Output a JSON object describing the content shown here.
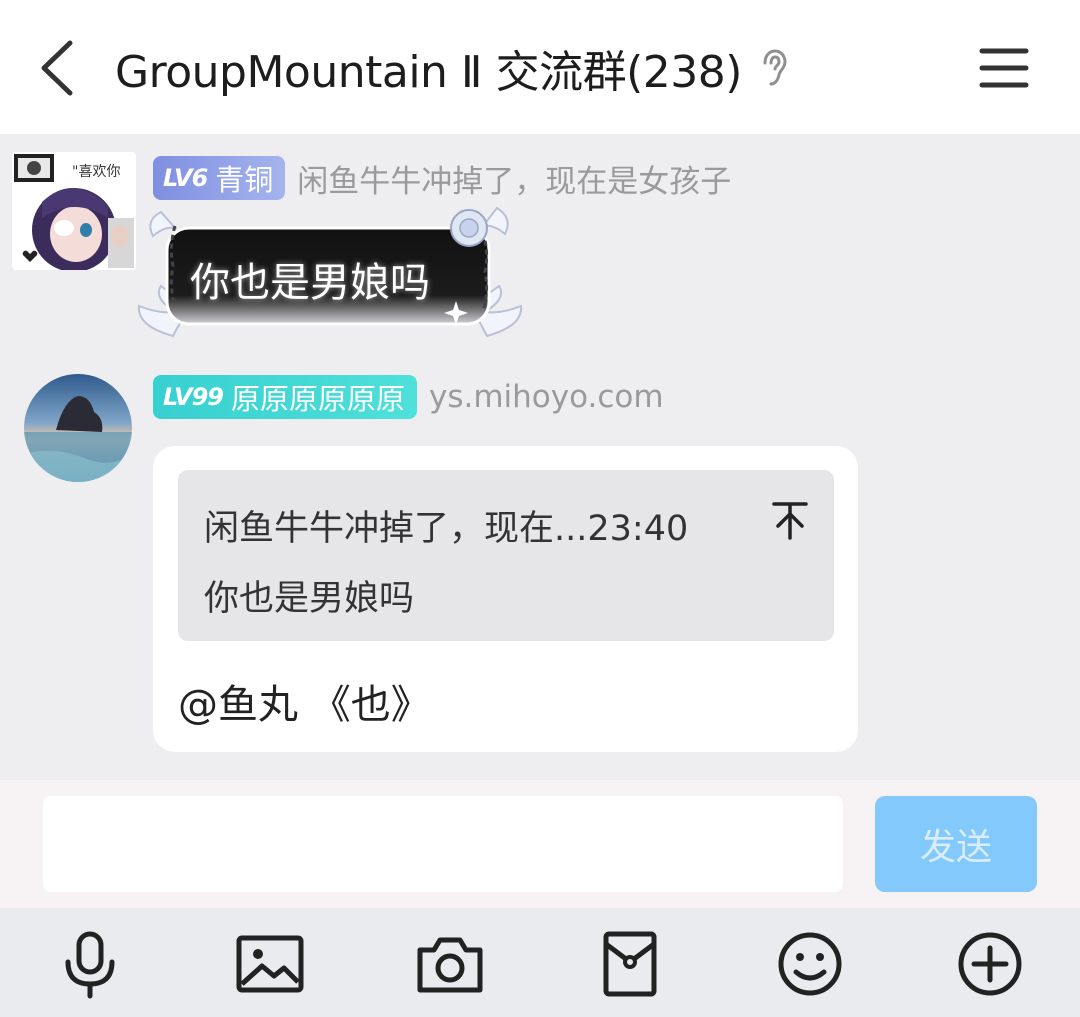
{
  "header": {
    "title": "GroupMountain Ⅱ 交流群(238)",
    "back_icon": "chevron-left-icon",
    "listen_icon": "ear-icon",
    "menu_icon": "hamburger-menu-icon"
  },
  "messages": [
    {
      "level": "LV6",
      "rank": "青铜",
      "badge_color": "#8b9ae6",
      "nickname": "闲鱼牛牛冲掉了，现在是女孩子",
      "bubble_text": "你也是男娘吗"
    },
    {
      "level": "LV99",
      "rank": "原原原原原原",
      "badge_color": "#3dd6d4",
      "nickname": "ys.mihoyo.com",
      "quote": {
        "header": "闲鱼牛牛冲掉了，现在...23:40",
        "text": "你也是男娘吗",
        "top_icon": "scroll-to-top-icon"
      },
      "reply_text": "@鱼丸 《也》"
    }
  ],
  "input": {
    "value": "",
    "placeholder": "",
    "send_label": "发送",
    "send_color": "#84c9fb"
  },
  "toolbar": {
    "icons": [
      "microphone-icon",
      "image-icon",
      "camera-icon",
      "red-packet-icon",
      "emoji-icon",
      "plus-icon"
    ]
  }
}
